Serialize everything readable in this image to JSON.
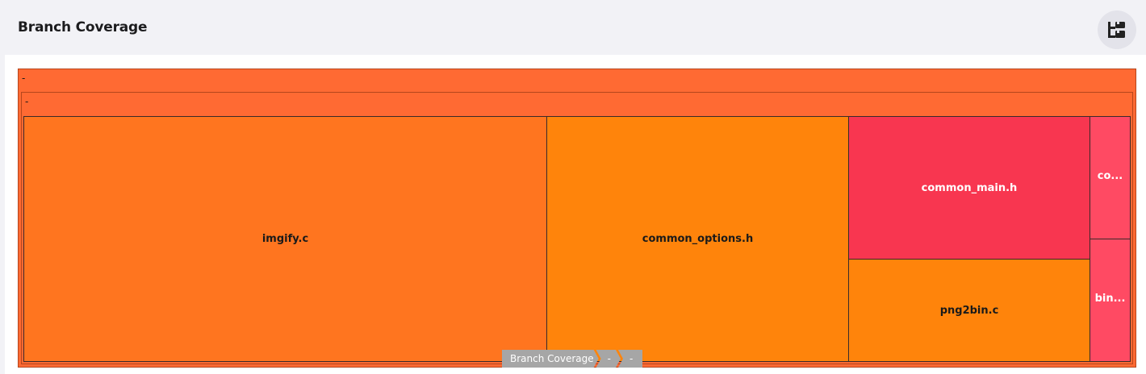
{
  "header": {
    "title": "Branch Coverage",
    "tree_button_icon": "tree-view-icon"
  },
  "colors": {
    "root": "#ff6a33",
    "inner": "#ff6a33",
    "imgify": "#ff751f",
    "common_options": "#ff840b",
    "common_main": "#f83650",
    "png2bin": "#ff840b",
    "co": "#ff4a63",
    "bin": "#ff4a63"
  },
  "chart_data": {
    "type": "treemap",
    "title": "Branch Coverage",
    "root": {
      "name": "-",
      "children": [
        {
          "name": "-",
          "children": [
            {
              "name": "imgify.c",
              "label": "imgify.c"
            },
            {
              "name": "common_options.h",
              "label": "common_options.h"
            },
            {
              "name": "common_main.h",
              "label": "common_main.h"
            },
            {
              "name": "png2bin.c",
              "label": "png2bin.c"
            },
            {
              "name": "co...",
              "label": "co..."
            },
            {
              "name": "bin...",
              "label": "bin..."
            }
          ]
        }
      ]
    },
    "breadcrumb": [
      "Branch Coverage",
      "-",
      "-"
    ]
  }
}
